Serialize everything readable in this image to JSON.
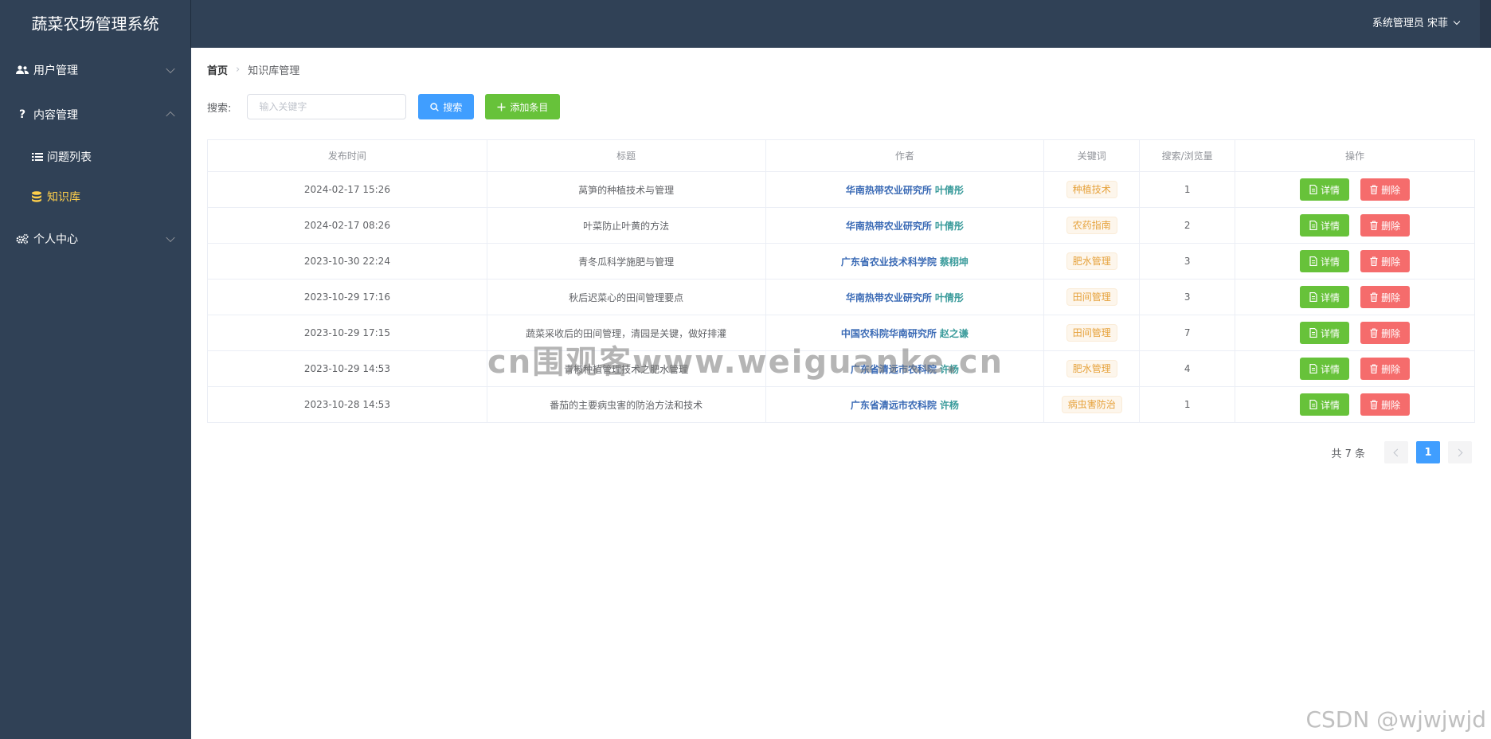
{
  "app": {
    "title": "蔬菜农场管理系统"
  },
  "header": {
    "user": "系统管理员 宋菲"
  },
  "sidebar": {
    "menus": [
      {
        "label": "用户管理",
        "icon": "users-icon",
        "expanded": false
      },
      {
        "label": "内容管理",
        "icon": "question-icon",
        "expanded": true,
        "children": [
          {
            "label": "问题列表",
            "icon": "list-icon",
            "active": false
          },
          {
            "label": "知识库",
            "icon": "database-icon",
            "active": true
          }
        ]
      },
      {
        "label": "个人中心",
        "icon": "gears-icon",
        "expanded": false
      }
    ]
  },
  "breadcrumb": {
    "home": "首页",
    "current": "知识库管理"
  },
  "toolbar": {
    "search_label": "搜索:",
    "search_placeholder": "输入关键字",
    "search_value": "",
    "search_button": "搜索",
    "add_button": "添加条目"
  },
  "table": {
    "columns": [
      "发布时间",
      "标题",
      "作者",
      "关键词",
      "搜索/浏览量",
      "操作"
    ],
    "rows": [
      {
        "time": "2024-02-17 15:26",
        "title": "莴笋的种植技术与管理",
        "org": "华南热带农业研究所",
        "name": "叶倩彤",
        "keyword": "种植技术",
        "views": "1"
      },
      {
        "time": "2024-02-17 08:26",
        "title": "叶菜防止叶黄的方法",
        "org": "华南热带农业研究所",
        "name": "叶倩彤",
        "keyword": "农药指南",
        "views": "2"
      },
      {
        "time": "2023-10-30 22:24",
        "title": "青冬瓜科学施肥与管理",
        "org": "广东省农业技术科学院",
        "name": "蔡栩坤",
        "keyword": "肥水管理",
        "views": "3"
      },
      {
        "time": "2023-10-29 17:16",
        "title": "秋后迟菜心的田间管理要点",
        "org": "华南热带农业研究所",
        "name": "叶倩彤",
        "keyword": "田间管理",
        "views": "3"
      },
      {
        "time": "2023-10-29 17:15",
        "title": "蔬菜采收后的田间管理，清园是关键，做好排灌",
        "org": "中国农科院华南研究所",
        "name": "赵之谦",
        "keyword": "田间管理",
        "views": "7"
      },
      {
        "time": "2023-10-29 14:53",
        "title": "青椒种植管理技术之肥水管理",
        "org": "广东省清远市农科院",
        "name": "许杨",
        "keyword": "肥水管理",
        "views": "4"
      },
      {
        "time": "2023-10-28 14:53",
        "title": "番茄的主要病虫害的防治方法和技术",
        "org": "广东省清远市农科院",
        "name": "许杨",
        "keyword": "病虫害防治",
        "views": "1"
      }
    ],
    "detail_label": "详情",
    "delete_label": "删除"
  },
  "pagination": {
    "total": "共 7 条",
    "current": "1"
  },
  "watermarks": {
    "center": "cn围观客www.weiguanke.cn",
    "corner": "CSDN @wjwjwjd"
  },
  "colors": {
    "sidebar": "#304156",
    "primary": "#409eff",
    "success": "#67c23a",
    "danger": "#f56c6c",
    "active_menu": "#ffd04b",
    "tag": "#e6a23c"
  }
}
